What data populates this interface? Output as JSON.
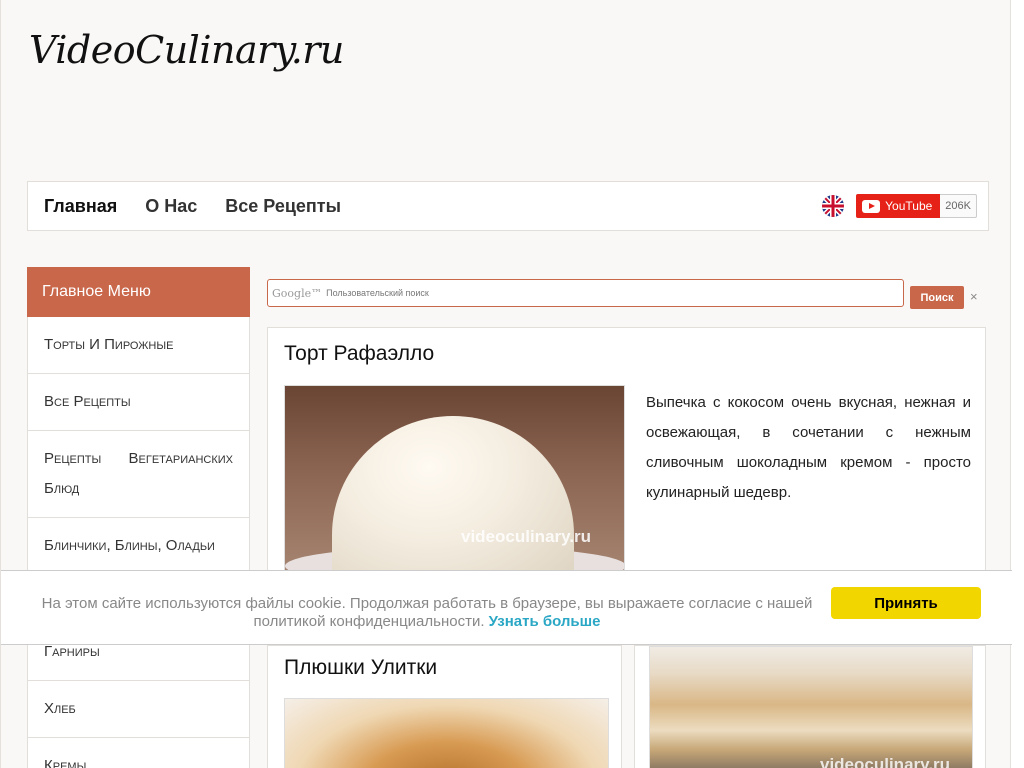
{
  "site": {
    "logo": "VideoCulinary.ru"
  },
  "nav": {
    "items": [
      "Главная",
      "О Нас",
      "Все Рецепты"
    ],
    "youtube_label": "YouTube",
    "youtube_count": "206K"
  },
  "sidebar": {
    "header": "Главное Меню",
    "items": [
      "Торты И Пирожные",
      "Все Рецепты",
      "Рецепты Вегетарианских Блюд",
      "Блинчики, Блины, Оладьи",
      "Гарниры",
      "Хлеб",
      "Кремы"
    ]
  },
  "search": {
    "logo": "Google™",
    "placeholder": "Пользовательский поиск",
    "button": "Поиск",
    "clear": "×"
  },
  "main": {
    "recipe1": {
      "title": "Торт Рафаэлло",
      "watermark": "videoculinary.ru",
      "description": "Выпечка с кокосом очень вкусная, нежная и освежающая, в сочетании с нежным сливочным шоколадным кремом - просто кулинарный шедевр."
    },
    "recipe2": {
      "title": "Плюшки Улитки"
    },
    "recipe3": {
      "watermark": "videoculinary.ru"
    }
  },
  "cookie": {
    "text": "На этом сайте используются файлы cookie. Продолжая работать в браузере, вы выражаете согласие с нашей политикой конфиденциальности.",
    "link": "Узнать больше",
    "accept": "Принять"
  },
  "colors": {
    "accent": "#c9674a",
    "youtube": "#e62117",
    "cookie_button": "#f1d600",
    "link": "#2aa7c5"
  }
}
